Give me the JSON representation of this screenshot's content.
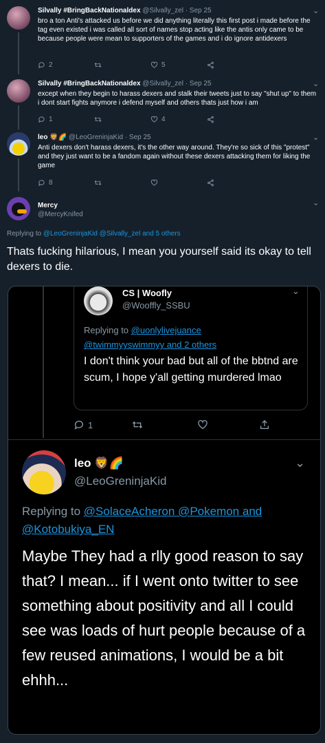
{
  "tweets": [
    {
      "name": "Silvally #BringBackNationaldex",
      "handle": "@Silvally_zel",
      "date": "· Sep 25",
      "text": "bro a ton Anti's attacked us before we did anything literally this first post i made before the tag even existed i was called all sort of names stop acting like the antis only came to be because people were mean to supporters of the games and i do ignore antidexers",
      "replies": "2",
      "likes": "5"
    },
    {
      "name": "Silvally #BringBackNationaldex",
      "handle": "@Silvally_zel",
      "date": "· Sep 25",
      "text": "except when they begin to harass dexers and stalk their tweets just to say \"shut up\" to them i dont start fights anymore i defend myself and others thats just how i am",
      "replies": "1",
      "likes": "4"
    },
    {
      "name": "leo",
      "emojis": "🦁🌈",
      "handle": "@LeoGreninjaKid",
      "date": "· Sep 25",
      "text": "Anti dexers don't harass dexers, it's the other way around. They're so sick of this \"protest\" and they just want to be a fandom again without these dexers attacking them for liking the game",
      "replies": "8"
    }
  ],
  "main": {
    "name": "Mercy",
    "handle": "@MercyKnifed",
    "replying_prefix": "Replying to ",
    "replying_to": "@LeoGreninjaKid @Silvally_zel and 5 others",
    "text": "Thats fucking hilarious, I mean you yourself said its okay to tell dexers to die."
  },
  "screenshot": {
    "inner": {
      "name": "CS | Woofly",
      "handle": "@Wooffly_SSBU",
      "replying_prefix": "Replying to ",
      "replying_line1": "@uonlylivejuance",
      "replying_line2": "@twimmyyswimmyy and 2 others",
      "text": "I don't think your bad but all of the bbtnd are scum, I hope y'all getting murdered lmao",
      "replies": "1"
    },
    "outer": {
      "name": "leo",
      "emojis": "🦁🌈",
      "handle": "@LeoGreninjaKid",
      "replying_prefix": "Replying to ",
      "replying_line1": "@SolaceAcheron @Pokemon and",
      "replying_line2": "@Kotobukiya_EN",
      "text": "Maybe They had a rlly good reason to say that? I mean... if I went onto twitter to see something about positivity and all I could see was loads of hurt people because of a few reused animations, I would be a bit ehhh..."
    }
  },
  "colors": {
    "background": "#15202b",
    "link": "#1b95e0",
    "muted": "#8899a6"
  }
}
